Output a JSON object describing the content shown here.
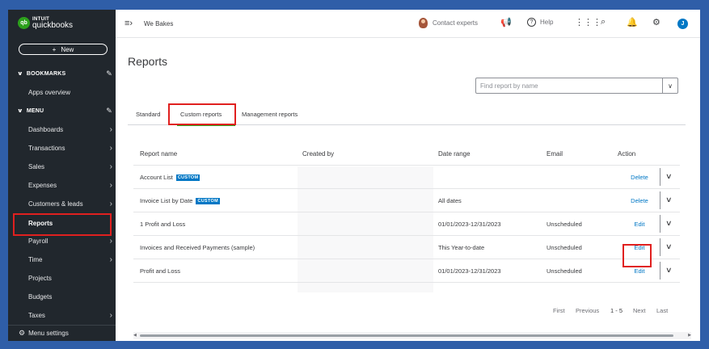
{
  "app": {
    "brand_top": "INTUIT",
    "brand_name": "quickbooks",
    "brand_badge": "qb"
  },
  "sidebar": {
    "new_label": "New",
    "bookmarks_label": "BOOKMARKS",
    "apps_overview": "Apps overview",
    "menu_label": "MENU",
    "items": [
      {
        "label": "Dashboards"
      },
      {
        "label": "Transactions"
      },
      {
        "label": "Sales"
      },
      {
        "label": "Expenses"
      },
      {
        "label": "Customers & leads"
      },
      {
        "label": "Reports"
      },
      {
        "label": "Payroll"
      },
      {
        "label": "Time"
      },
      {
        "label": "Projects"
      },
      {
        "label": "Budgets"
      },
      {
        "label": "Taxes"
      }
    ],
    "menu_settings": "Menu settings"
  },
  "topbar": {
    "company": "We Bakes",
    "contact_experts": "Contact experts",
    "help": "Help",
    "user_initial": "J"
  },
  "page": {
    "title": "Reports",
    "search_placeholder": "Find report by name",
    "tabs": [
      {
        "label": "Standard"
      },
      {
        "label": "Custom reports"
      },
      {
        "label": "Management reports"
      }
    ]
  },
  "table": {
    "headers": {
      "name": "Report name",
      "created_by": "Created by",
      "date_range": "Date range",
      "email": "Email",
      "action": "Action"
    },
    "rows": [
      {
        "name": "Account List",
        "badge": "CUSTOM",
        "created_by": "",
        "date_range": "",
        "email": "",
        "action": "Delete"
      },
      {
        "name": "Invoice List by Date",
        "badge": "CUSTOM",
        "created_by": "",
        "date_range": "All dates",
        "email": "",
        "action": "Delete"
      },
      {
        "name": "1 Profit and Loss",
        "badge": "",
        "created_by": "",
        "date_range": "01/01/2023-12/31/2023",
        "email": "Unscheduled",
        "action": "Edit"
      },
      {
        "name": "Invoices and Received Payments (sample)",
        "badge": "",
        "created_by": "",
        "date_range": "This Year-to-date",
        "email": "Unscheduled",
        "action": "Edit"
      },
      {
        "name": "Profit and Loss",
        "badge": "",
        "created_by": "",
        "date_range": "01/01/2023-12/31/2023",
        "email": "Unscheduled",
        "action": "Edit"
      }
    ]
  },
  "pagination": {
    "first": "First",
    "previous": "Previous",
    "range": "1 - 5",
    "next": "Next",
    "last": "Last"
  },
  "colors": {
    "sidebar_bg": "#21272d",
    "accent_green": "#2ca01c",
    "link_blue": "#0077c5",
    "highlight_red": "#e0201f",
    "frame_blue": "#2f5ea8"
  }
}
